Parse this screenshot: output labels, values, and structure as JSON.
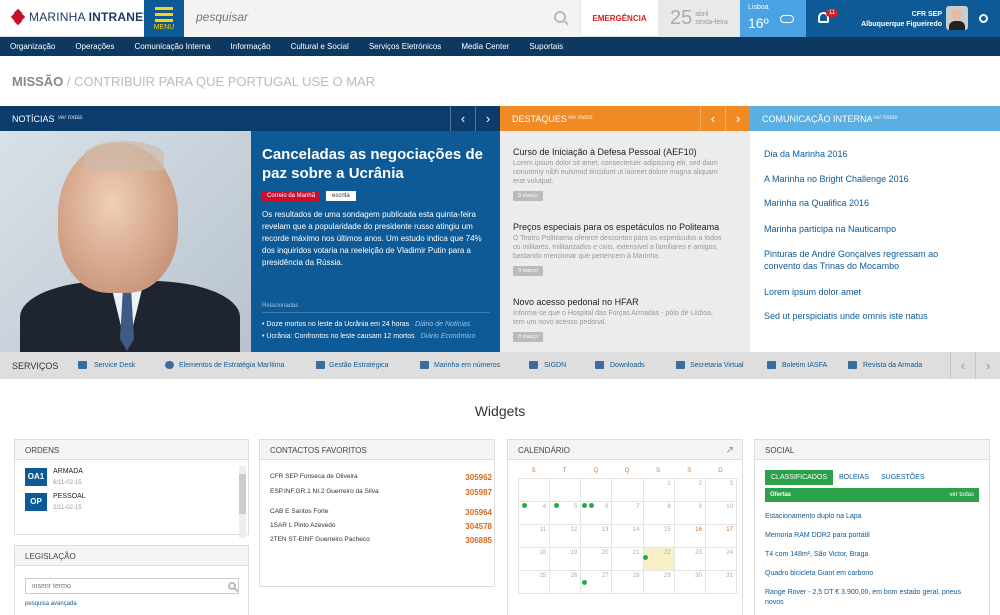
{
  "header": {
    "logo_text_1": "MARINHA",
    "logo_text_2": "INTRANET",
    "menu_label": "MENU",
    "search_placeholder": "pesquisar",
    "emergency": "EMERGÊNCIA",
    "date_day": "25",
    "date_month": "abril",
    "date_weekday": "sexta-feira",
    "weather_city": "Lisboa",
    "weather_temp": "16º",
    "notifications": "11",
    "user_line1": "CFR SEP",
    "user_line2": "Albuquerque Figueiredo"
  },
  "nav": [
    "Organização",
    "Operações",
    "Comunicação Interna",
    "Informação",
    "Cultural e Social",
    "Serviços Eletrónicos",
    "Media Center",
    "Suportais"
  ],
  "mission": {
    "label": "MISSÃO",
    "sep": " / ",
    "text": "CONTRIBUIR PARA QUE PORTUGAL USE O MAR"
  },
  "strips": {
    "news": "NOTÍCIAS",
    "highlights": "DESTAQUES",
    "comm": "COMUNICAÇÃO INTERNA",
    "see_all": "ver todas",
    "see_all_2": "ver todos",
    "see_all_3": "ver todas",
    "prev": "‹",
    "next": "›"
  },
  "news": {
    "title": "Canceladas as negociações de paz sobre a Ucrânia",
    "tag_source": "Correio da Manhã",
    "tag_type": "escrita",
    "body": "Os resultados de uma sondagem publicada esta quinta-feira revelam que a popularidade do presidente russo atingiu um recorde máximo nos últimos anos. Um estudo indica que 74% dos inquiridos votaria na reeleição de Vladimir Putin para a presidência da Rússia.",
    "related_label": "Relacionadas",
    "related": [
      {
        "text": "Doze mortos no leste da Ucrânia em 24 horas",
        "source": "Diário de Notícias"
      },
      {
        "text": "Ucrânia: Confrontos no leste causam 12 mortos",
        "source": "Diário Económico"
      }
    ]
  },
  "highlights": [
    {
      "title": "Curso de Iniciação à Defesa Pessoal (AEF10)",
      "text": "Lorem ipsum dolor sit amet, consectetuer adipiscing elit, sed diam nonummy nibh euismod tincidunt ut laoreet dolore magna aliquam erat volutpat.",
      "date": "3 março"
    },
    {
      "title": "Preços especiais para os espetáculos no Politeama",
      "text": "O Teatro Politeama oferece descontos para os espetáculos a todos os militares, militarizados e civis, extensível a familiares e amigos, bastando mencionar que pertencem à Marinha.",
      "date": "3 março"
    },
    {
      "title": "Novo acesso pedonal no HFAR",
      "text": "Informa-se que o Hospital das Forças Armadas - pólo de Lisboa, tem um novo acesso pedonal.",
      "date": "3 março"
    }
  ],
  "comm": [
    "Dia da Marinha 2016",
    "A Marinha no Bright Challenge 2016",
    "Marinha na Qualifica 2016",
    "Marinha participa na Nauticampo",
    "Pinturas de André Gonçalves regressam ao convento das Trinas do Mocambo",
    "Lorem ipsum dolor amet",
    "Sed ut perspiciatis unde omnis iste natus"
  ],
  "services": {
    "label": "SERVIÇOS",
    "items": [
      "Service Desk",
      "Elementos de Estratégia Marítima",
      "Gestão Estratégica",
      "Marinha em números",
      "SIGDN",
      "Downloads",
      "Secretaria Virtual",
      "Boletim IASFA",
      "Revista da Armada"
    ]
  },
  "widgets_title": "Widgets",
  "orders": {
    "title": "ORDENS",
    "items": [
      {
        "code": "OA1",
        "name": "ARMADA",
        "date": "6/11-02-15"
      },
      {
        "code": "OP",
        "name": "PESSOAL",
        "date": "2/11-02-15"
      }
    ]
  },
  "contacts": {
    "title": "CONTACTOS FAVORITOS",
    "items": [
      {
        "name": "CFR SEP Fonseca de Oliveira",
        "num": "305962"
      },
      {
        "name": "ESP.INF.GR.1 NI.2 Guerreiro da Silva",
        "num": "305987"
      },
      {
        "name": "CAB E Santos Forte",
        "num": "305964"
      },
      {
        "name": "1SAR L Pinto Azevedo",
        "num": "304578"
      },
      {
        "name": "2TEN ST-EINF Guerreiro Pacheco",
        "num": "306885"
      }
    ]
  },
  "calendar": {
    "title": "CALENDÁRIO",
    "days": [
      "S",
      "T",
      "Q",
      "Q",
      "S",
      "S",
      "D"
    ],
    "rows": [
      [
        "",
        "",
        "",
        "",
        "1",
        "2",
        "3"
      ],
      [
        "4",
        "5",
        "6",
        "7",
        "8",
        "9",
        "10"
      ],
      [
        "11",
        "12",
        "13",
        "14",
        "15",
        "16",
        "17"
      ],
      [
        "18",
        "19",
        "20",
        "21",
        "22",
        "23",
        "24"
      ],
      [
        "25",
        "26",
        "27",
        "28",
        "29",
        "30",
        "31"
      ]
    ]
  },
  "legislation": {
    "title": "LEGISLAÇÃO",
    "placeholder": "inserir termo",
    "advanced": "pesquisa avançada"
  },
  "social": {
    "title": "SOCIAL",
    "tabs": [
      "CLASSIFICADOS",
      "BOLEIAS",
      "SUGESTÕES"
    ],
    "head": "Ofertas",
    "see_all": "ver todas",
    "items": [
      "Estacionamento duplo na Lapa",
      "Memoria RAM DDR2 para portátil",
      "T4 com 148m², São Victor, Braga",
      "Quadro bicicleta Giant em carbono",
      "Range Rover - 2,5 DT € 3.900,00, em bom estado geral, pneus novos"
    ]
  },
  "colors": {
    "navy": "#0c3c6c",
    "blue": "#0e5a96",
    "orange": "#f08a24",
    "sky": "#5aaee2",
    "green": "#2ba24a",
    "red": "#d32020"
  }
}
